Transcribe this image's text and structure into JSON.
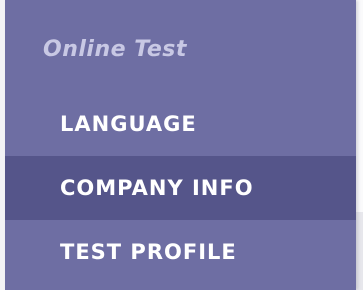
{
  "sidebar": {
    "section_title": "Online Test",
    "items": [
      {
        "label": "LANGUAGE",
        "active": false
      },
      {
        "label": "COMPANY INFO",
        "active": true
      },
      {
        "label": "TEST PROFILE",
        "active": false
      }
    ]
  },
  "colors": {
    "sidebar_bg": "#6e6ea3",
    "active_bg": "#55558a",
    "section_title": "#c8c8e4",
    "item_text": "#ffffff"
  }
}
